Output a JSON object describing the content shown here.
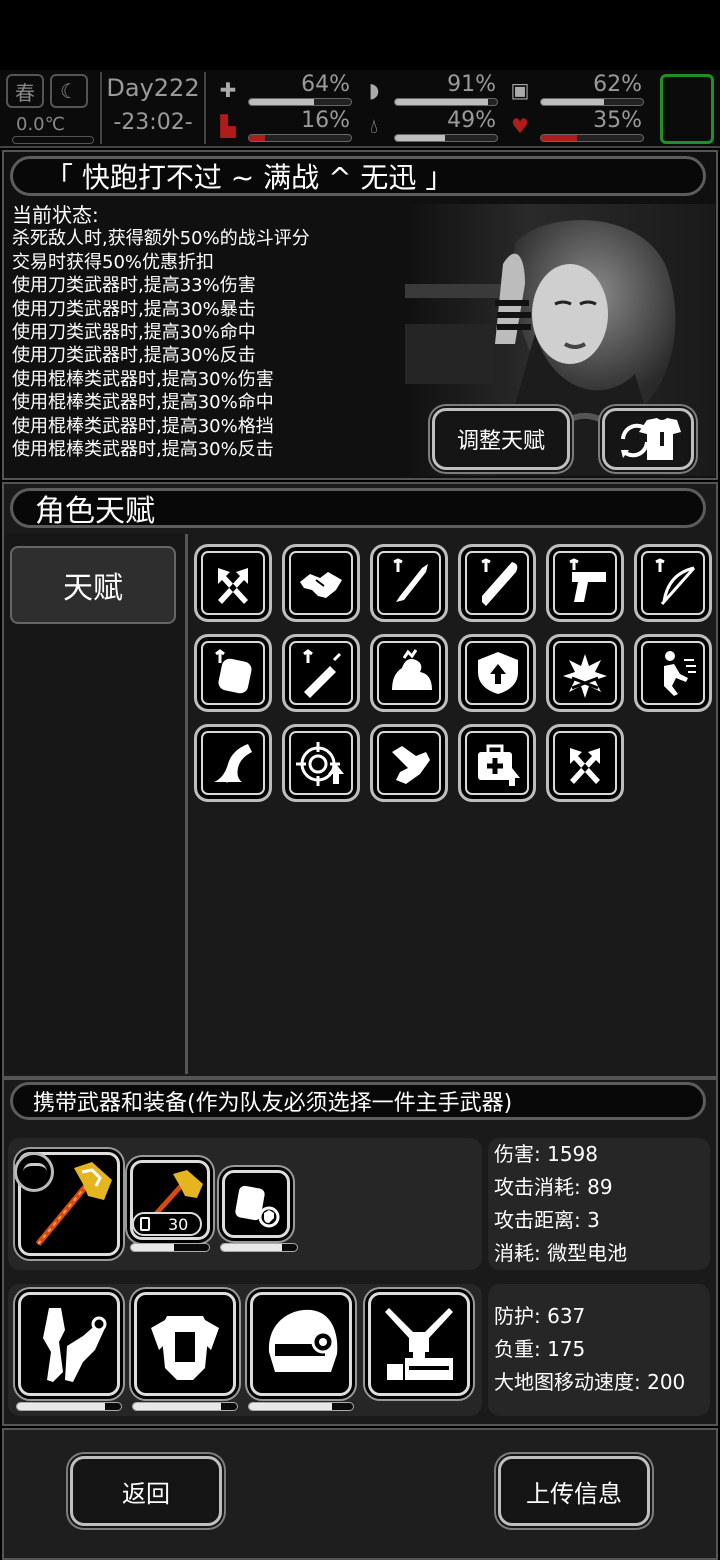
{
  "status": {
    "season": "春",
    "temperature": "0.0℃",
    "day": "Day222",
    "time": "-23:02-",
    "stats": [
      {
        "icon": "medkit-icon",
        "value": "64%",
        "fill": 0.64,
        "color": "#bdbdbd"
      },
      {
        "icon": "stomach-icon",
        "value": "91%",
        "fill": 0.91,
        "color": "#bdbdbd"
      },
      {
        "icon": "battery-icon",
        "value": "62%",
        "fill": 0.62,
        "color": "#bdbdbd"
      },
      {
        "icon": "boot-icon",
        "value": "16%",
        "fill": 0.16,
        "color": "#b01c1c"
      },
      {
        "icon": "water-drop-icon",
        "value": "49%",
        "fill": 0.49,
        "color": "#bdbdbd"
      },
      {
        "icon": "heart-icon",
        "value": "35%",
        "fill": 0.35,
        "color": "#b01c1c"
      }
    ]
  },
  "character": {
    "title": "「 快跑打不过 ~ 满战 ^ 无迅 」",
    "status_header": "当前状态:",
    "buffs": [
      "杀死敌人时,获得额外50%的战斗评分",
      "交易时获得50%优惠折扣",
      "使用刀类武器时,提高33%伤害",
      "使用刀类武器时,提高30%暴击",
      "使用刀类武器时,提高30%命中",
      "使用刀类武器时,提高30%反击",
      "使用棍棒类武器时,提高30%伤害",
      "使用棍棒类武器时,提高30%命中",
      "使用棍棒类武器时,提高30%格挡",
      "使用棍棒类武器时,提高30%反击"
    ],
    "adjust_button": "调整天赋"
  },
  "talents": {
    "title": "角色天赋",
    "tab_label": "天赋",
    "icons": [
      "crossed-axes-icon",
      "handshake-icon",
      "blade-up-icon",
      "club-up-icon",
      "pistol-up-icon",
      "bow-up-icon",
      "armor-up-icon",
      "syringe-up-icon",
      "muscle-icon",
      "shield-up-icon",
      "explosion-icon",
      "sprint-icon",
      "path-icon",
      "target-up-icon",
      "arm-icon",
      "medkit-up-icon",
      "crossed-hammers-icon"
    ]
  },
  "equipment": {
    "title": "携带武器和装备(作为队友必须选择一件主手武器)",
    "weapon_ammo": "30",
    "weapon_stats": [
      "伤害: 1598",
      "攻击消耗: 89",
      "攻击距离: 3",
      "消耗: 微型电池"
    ],
    "armor_stats": [
      "防护: 637",
      "负重: 175",
      "大地图移动速度: 200"
    ],
    "durability": {
      "secondary_weapon": 0.55,
      "gear": 0.8,
      "armor1": 0.85,
      "armor2": 0.85,
      "armor3": 0.8
    }
  },
  "footer": {
    "back_button": "返回",
    "upload_button": "上传信息"
  }
}
